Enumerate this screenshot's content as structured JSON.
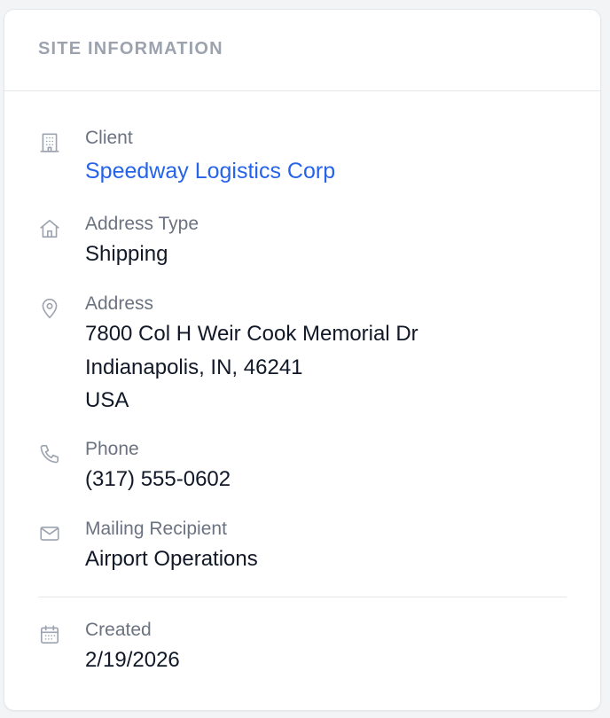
{
  "card": {
    "title": "SITE INFORMATION"
  },
  "fields": {
    "client": {
      "icon": "building-icon",
      "label": "Client",
      "value": "Speedway Logistics Corp"
    },
    "address_type": {
      "icon": "home-icon",
      "label": "Address Type",
      "value": "Shipping"
    },
    "address": {
      "icon": "map-pin-icon",
      "label": "Address",
      "lines": [
        "7800 Col H Weir Cook Memorial Dr",
        "Indianapolis, IN, 46241",
        "USA"
      ]
    },
    "phone": {
      "icon": "phone-icon",
      "label": "Phone",
      "value": "(317) 555-0602"
    },
    "mailing_recipient": {
      "icon": "mail-icon",
      "label": "Mailing Recipient",
      "value": "Airport Operations"
    },
    "created": {
      "icon": "calendar-icon",
      "label": "Created",
      "value": "2/19/2026"
    }
  },
  "colors": {
    "link": "#2563eb",
    "label": "#6b7280",
    "value": "#111827",
    "icon": "#9ca3af",
    "border": "#e5e7eb"
  }
}
